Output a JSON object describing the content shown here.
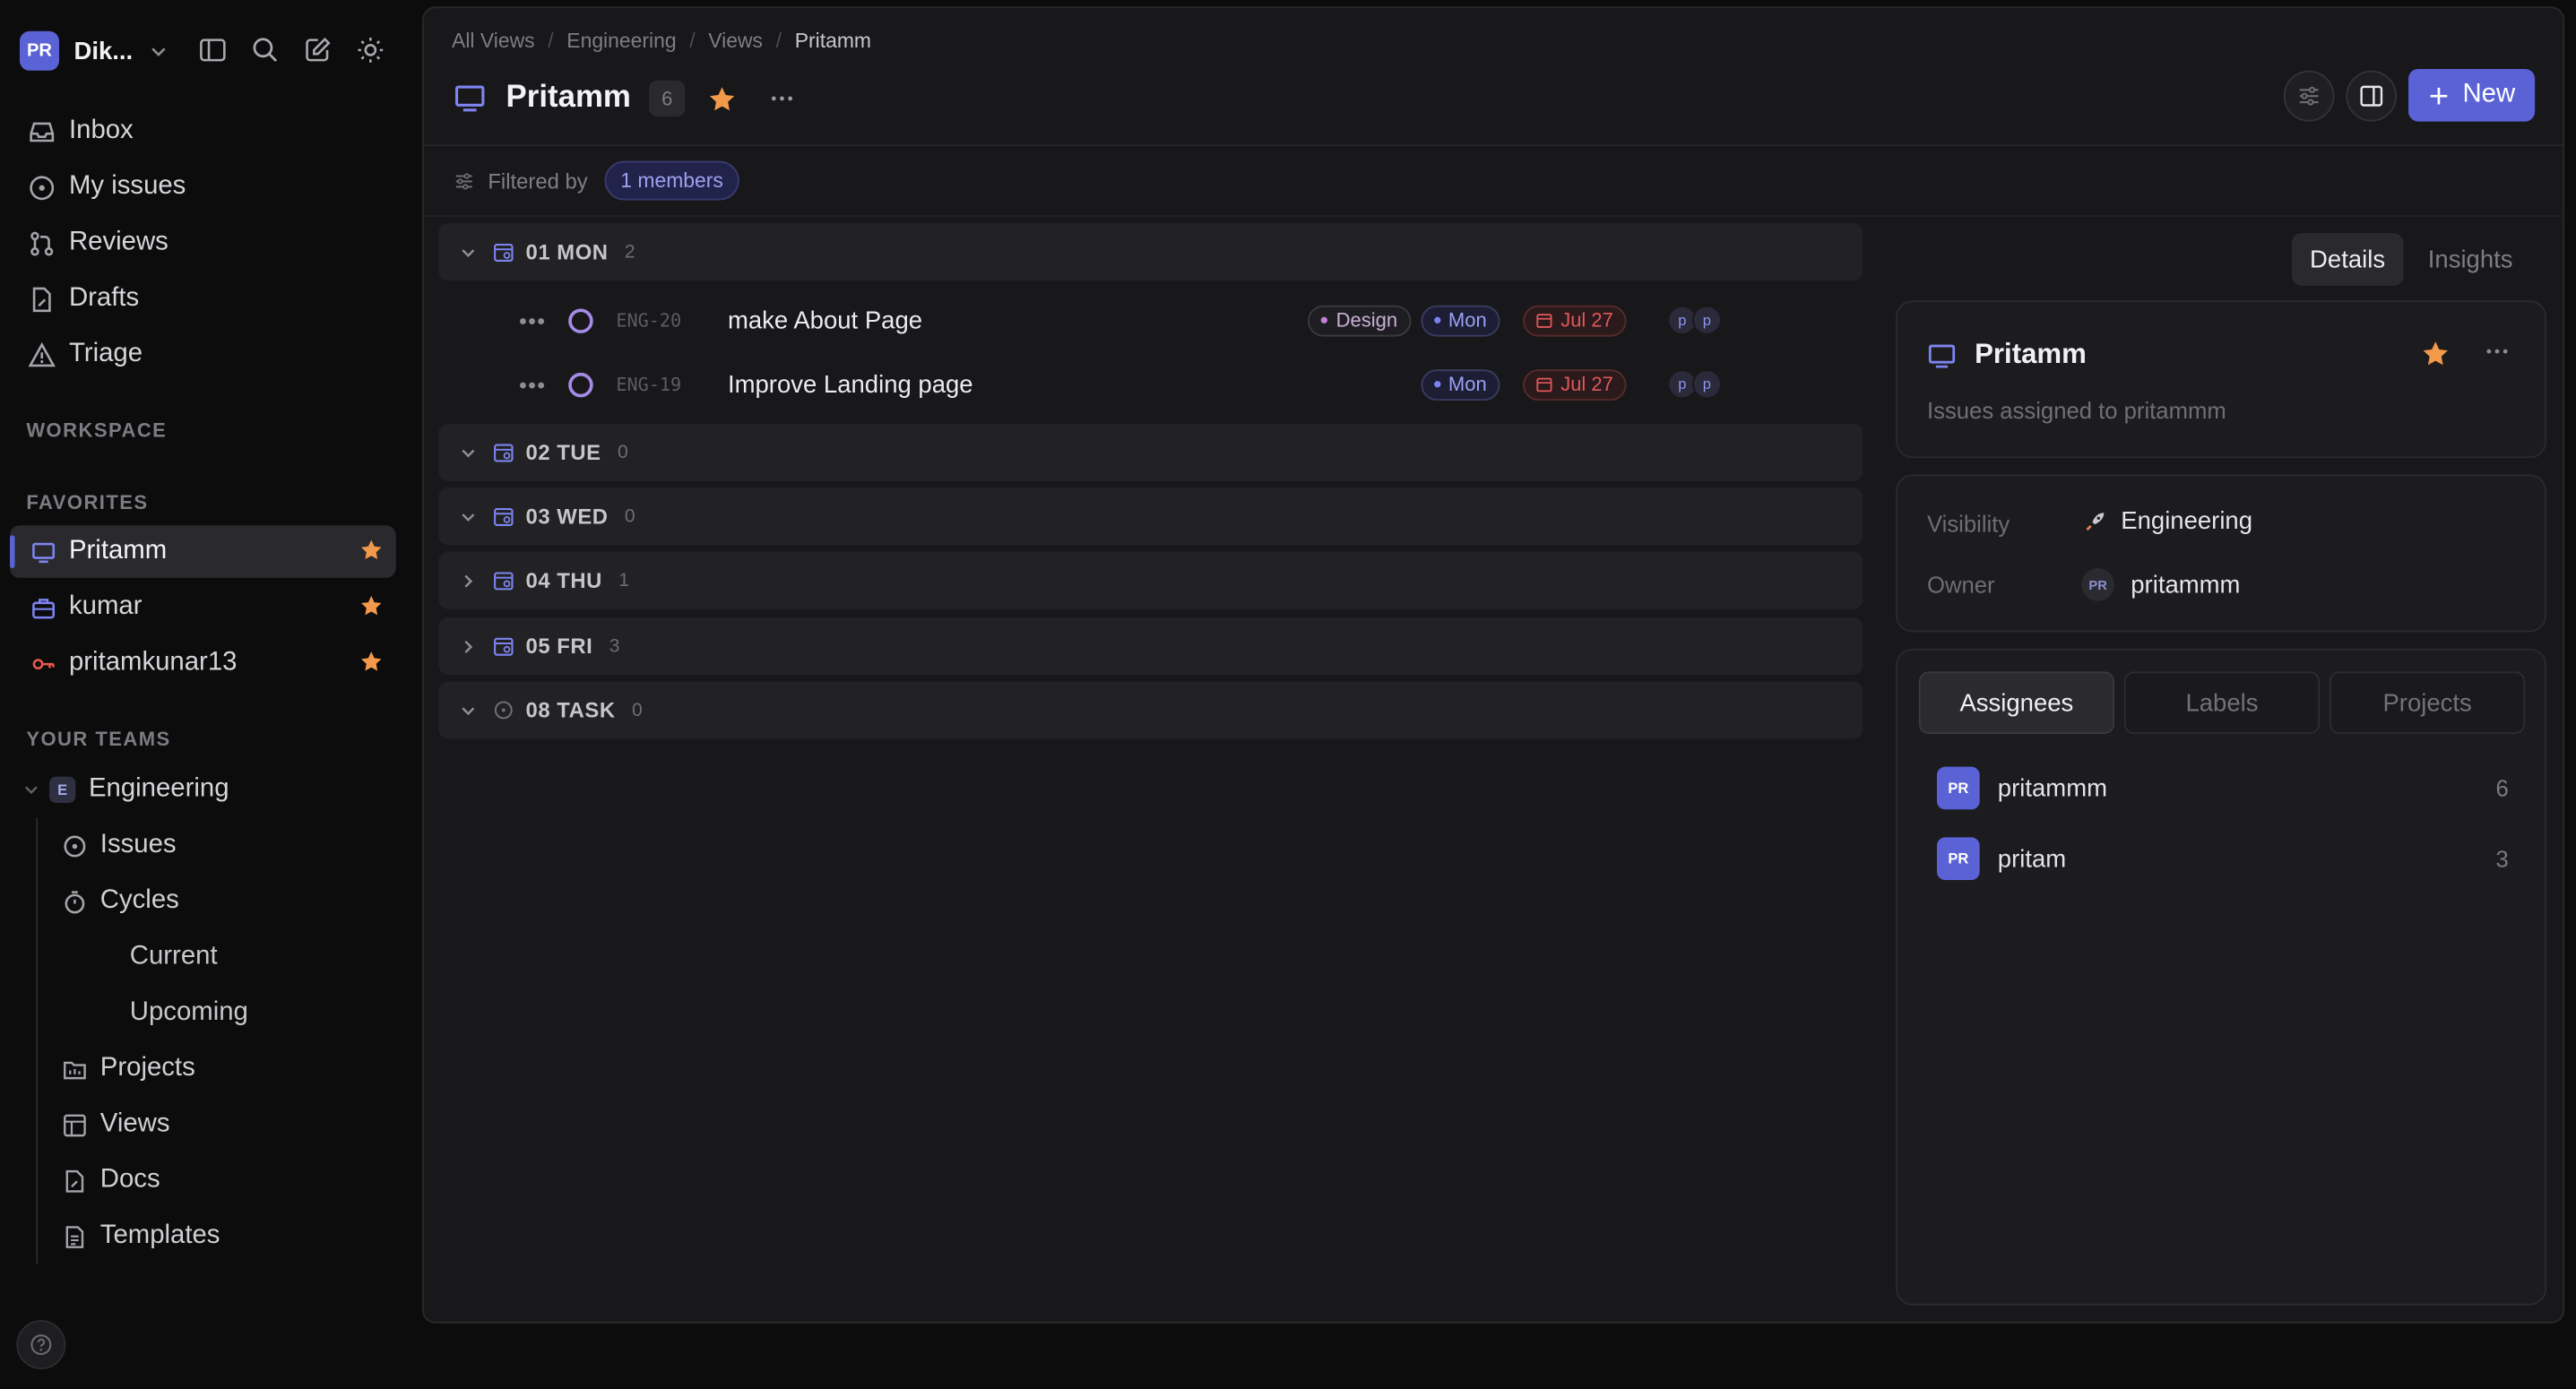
{
  "workspace": {
    "avatar": "PR",
    "name": "Dik...",
    "accent": "#5b62d6"
  },
  "sidebar": {
    "nav": [
      {
        "label": "Inbox",
        "icon": "inbox-icon"
      },
      {
        "label": "My issues",
        "icon": "target-icon"
      },
      {
        "label": "Reviews",
        "icon": "pull-request-icon"
      },
      {
        "label": "Drafts",
        "icon": "draft-icon"
      },
      {
        "label": "Triage",
        "icon": "triage-icon"
      }
    ],
    "workspace_label": "WORKSPACE",
    "favorites_label": "FAVORITES",
    "favorites": [
      {
        "label": "Pritamm",
        "icon": "monitor-icon",
        "active": true
      },
      {
        "label": "kumar",
        "icon": "briefcase-icon"
      },
      {
        "label": "pritamkunar13",
        "icon": "key-icon"
      }
    ],
    "teams_label": "YOUR TEAMS",
    "team": {
      "badge": "E",
      "name": "Engineering"
    },
    "team_items": [
      {
        "label": "Issues",
        "icon": "issues-icon"
      },
      {
        "label": "Cycles",
        "icon": "timer-icon"
      }
    ],
    "cycle_items": [
      {
        "label": "Current"
      },
      {
        "label": "Upcoming"
      }
    ],
    "team_items2": [
      {
        "label": "Projects",
        "icon": "projects-icon"
      },
      {
        "label": "Views",
        "icon": "views-icon"
      },
      {
        "label": "Docs",
        "icon": "docs-icon"
      },
      {
        "label": "Templates",
        "icon": "templates-icon"
      }
    ]
  },
  "header": {
    "breadcrumb": [
      "All Views",
      "Engineering",
      "Views",
      "Pritamm"
    ],
    "title": "Pritamm",
    "count": "6",
    "new_button": "New"
  },
  "filter": {
    "label": "Filtered by",
    "chip": "1 members"
  },
  "groups": [
    {
      "label": "01 MON",
      "count": "2",
      "expanded": true,
      "icon": "calendar-icon"
    },
    {
      "label": "02 TUE",
      "count": "0",
      "expanded": true,
      "icon": "calendar-icon"
    },
    {
      "label": "03 WED",
      "count": "0",
      "expanded": true,
      "icon": "calendar-icon"
    },
    {
      "label": "04 THU",
      "count": "1",
      "expanded": false,
      "icon": "calendar-icon"
    },
    {
      "label": "05 FRI",
      "count": "3",
      "expanded": false,
      "icon": "calendar-icon"
    },
    {
      "label": "08 TASK",
      "count": "0",
      "expanded": true,
      "icon": "circle-icon"
    }
  ],
  "issues": [
    {
      "id": "ENG-20",
      "title": "make About Page",
      "labels": [
        "Design",
        "Mon"
      ],
      "date": "Jul 27",
      "avatars": [
        "p",
        "p"
      ]
    },
    {
      "id": "ENG-19",
      "title": "Improve Landing page",
      "labels": [
        "Mon"
      ],
      "date": "Jul 27",
      "avatars": [
        "p",
        "p"
      ]
    }
  ],
  "right": {
    "tabs": [
      "Details",
      "Insights"
    ],
    "card_title": "Pritamm",
    "card_desc": "Issues assigned to pritammm",
    "visibility_label": "Visibility",
    "visibility_value": "Engineering",
    "owner_label": "Owner",
    "owner_avatar": "PR",
    "owner_value": "pritammm",
    "seg_tabs": [
      "Assignees",
      "Labels",
      "Projects"
    ],
    "assignees": [
      {
        "avatar": "PR",
        "name": "pritammm",
        "count": "6"
      },
      {
        "avatar": "PR",
        "name": "pritam",
        "count": "3"
      }
    ]
  },
  "colors": {
    "star": "#f2994a",
    "accent": "#5b62d6",
    "date_red": "#e0575b"
  }
}
